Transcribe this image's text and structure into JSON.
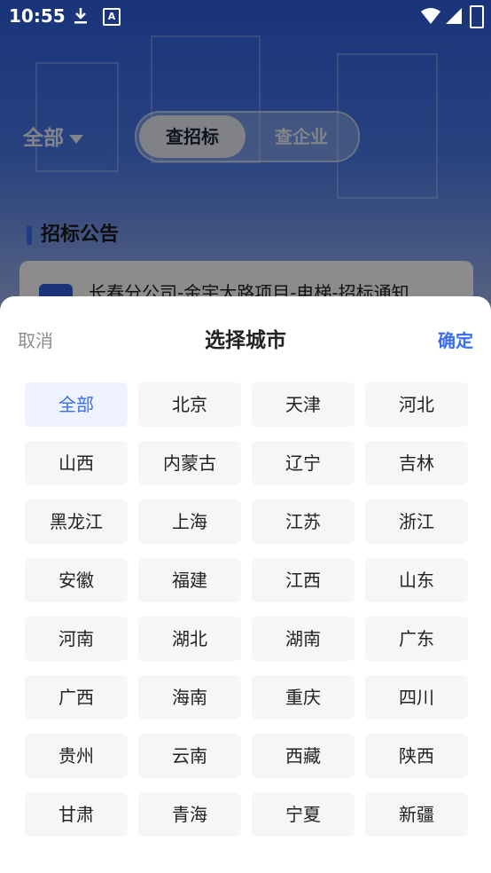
{
  "status_bar": {
    "time": "10:55"
  },
  "background": {
    "region_label": "全部",
    "tabs": [
      {
        "label": "查招标",
        "active": true
      },
      {
        "label": "查企业",
        "active": false
      }
    ],
    "section_title": "招标公告",
    "card_title": "长春分公司-金宇大路项目-电梯-招标通知"
  },
  "sheet": {
    "cancel_label": "取消",
    "title": "选择城市",
    "confirm_label": "确定",
    "selected": "全部",
    "cities": [
      "全部",
      "北京",
      "天津",
      "河北",
      "山西",
      "内蒙古",
      "辽宁",
      "吉林",
      "黑龙江",
      "上海",
      "江苏",
      "浙江",
      "安徽",
      "福建",
      "江西",
      "山东",
      "河南",
      "湖北",
      "湖南",
      "广东",
      "广西",
      "海南",
      "重庆",
      "四川",
      "贵州",
      "云南",
      "西藏",
      "陕西",
      "甘肃",
      "青海",
      "宁夏",
      "新疆"
    ]
  },
  "colors": {
    "accent": "#3a6cf4",
    "selected_bg": "#eef3ff",
    "cell_bg": "#f6f6f6"
  }
}
